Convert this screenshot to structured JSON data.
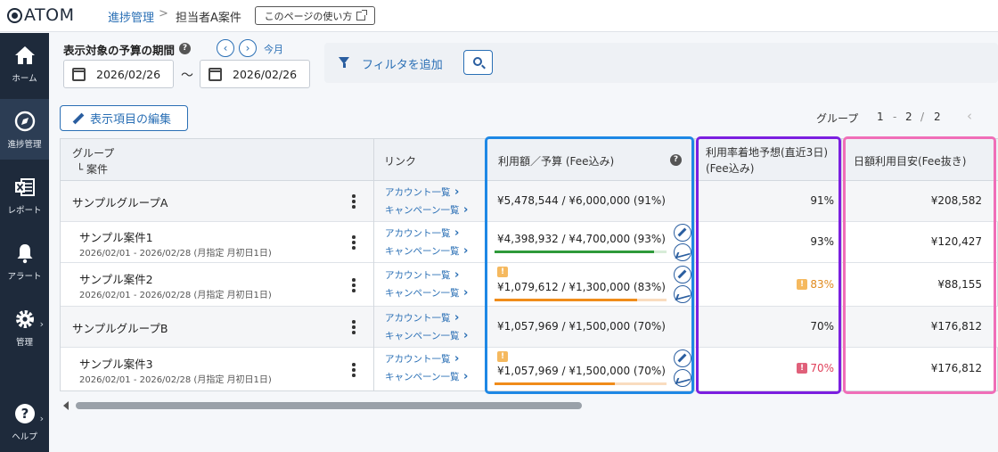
{
  "app": {
    "logo_text": "ATOM"
  },
  "breadcrumb": {
    "parent": "進捗管理",
    "separator": ">",
    "current": "担当者A案件"
  },
  "help_page_button": "このページの使い方",
  "sidebar": {
    "items": [
      {
        "label": "ホーム",
        "icon": "home-icon"
      },
      {
        "label": "進捗管理",
        "icon": "progress-icon",
        "active": true
      },
      {
        "label": "レポート",
        "icon": "excel-icon"
      },
      {
        "label": "アラート",
        "icon": "bell-icon"
      },
      {
        "label": "管理",
        "icon": "gear-icon"
      },
      {
        "label": "ヘルプ",
        "icon": "help-icon"
      }
    ]
  },
  "period": {
    "title": "表示対象の予算の期間",
    "today_label": "今月",
    "start_date": "2026/02/26",
    "tilde": "〜",
    "end_date": "2026/02/26"
  },
  "filter": {
    "add_label": "フィルタを追加"
  },
  "edit_columns_label": "表示項目の編集",
  "pager": {
    "label": "グループ",
    "from": "1",
    "dash": "-",
    "to": "2",
    "slash": "/",
    "total": "2",
    "prev": "‹"
  },
  "table": {
    "headers": {
      "group": "グループ",
      "case": "└ 案件",
      "link": "リンク",
      "usage": "利用額／予算 (Fee込み)",
      "forecast_line1": "利用率着地予想(直近3日)",
      "forecast_line2": "(Fee込み)",
      "daily": "日額利用目安(Fee抜き)"
    },
    "link_labels": {
      "account": "アカウント一覧",
      "campaign": "キャンペーン一覧"
    },
    "rows": [
      {
        "type": "group",
        "name": "サンプルグループA",
        "usage": "¥5,478,544 / ¥6,000,000 (91%)",
        "forecast": "91%",
        "daily": "¥208,582"
      },
      {
        "type": "case",
        "name": "サンプル案件1",
        "period": "2026/02/01 - 2026/02/28 (月指定 月初日1日)",
        "usage": "¥4,398,932 / ¥4,700,000 (93%)",
        "progress": 0.93,
        "bar_color": "#2e9a3a",
        "track_color": "#d7ecd8",
        "forecast": "93%",
        "daily": "¥120,427"
      },
      {
        "type": "case",
        "name": "サンプル案件2",
        "period": "2026/02/01 - 2026/02/28 (月指定 月初日1日)",
        "usage": "¥1,079,612 / ¥1,300,000 (83%)",
        "progress": 0.83,
        "bar_color": "#f08c1a",
        "track_color": "#f9dcbf",
        "warn": "!",
        "warn_color": "#f5b95f",
        "forecast": "83%",
        "forecast_warn": "!",
        "forecast_color": "#e08a1e",
        "daily": "¥88,155"
      },
      {
        "type": "group",
        "name": "サンプルグループB",
        "usage": "¥1,057,969 / ¥1,500,000 (70%)",
        "forecast": "70%",
        "daily": "¥176,812"
      },
      {
        "type": "case",
        "name": "サンプル案件3",
        "period": "2026/02/01 - 2026/02/28 (月指定 月初日1日)",
        "usage": "¥1,057,969 / ¥1,500,000 (70%)",
        "progress": 0.7,
        "bar_color": "#f08c1a",
        "track_color": "#f9dcbf",
        "warn": "!",
        "warn_color": "#f5b95f",
        "forecast": "70%",
        "forecast_warn": "!",
        "forecast_color": "#e0405a",
        "daily": "¥176,812"
      }
    ]
  },
  "highlight_colors": {
    "usage": "#1e88e5",
    "forecast": "#7b1fe0",
    "daily": "#f06eb8"
  }
}
